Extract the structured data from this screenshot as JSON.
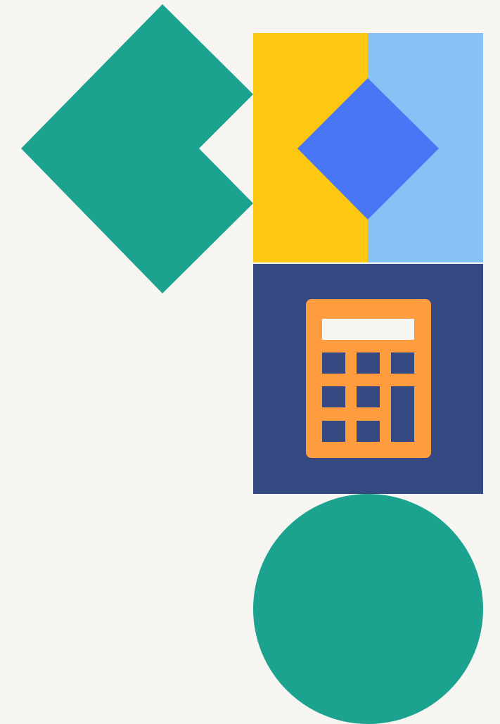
{
  "colors": {
    "background": "#F7F5F1",
    "teal": "#1BA38F",
    "yellow": "#FEC712",
    "light_blue": "#87C2F7",
    "blue": "#4876F5",
    "navy": "#344982",
    "orange": "#FF9C40",
    "display": "#F7F5F1"
  },
  "icons": {
    "calculator": "calculator-icon"
  }
}
